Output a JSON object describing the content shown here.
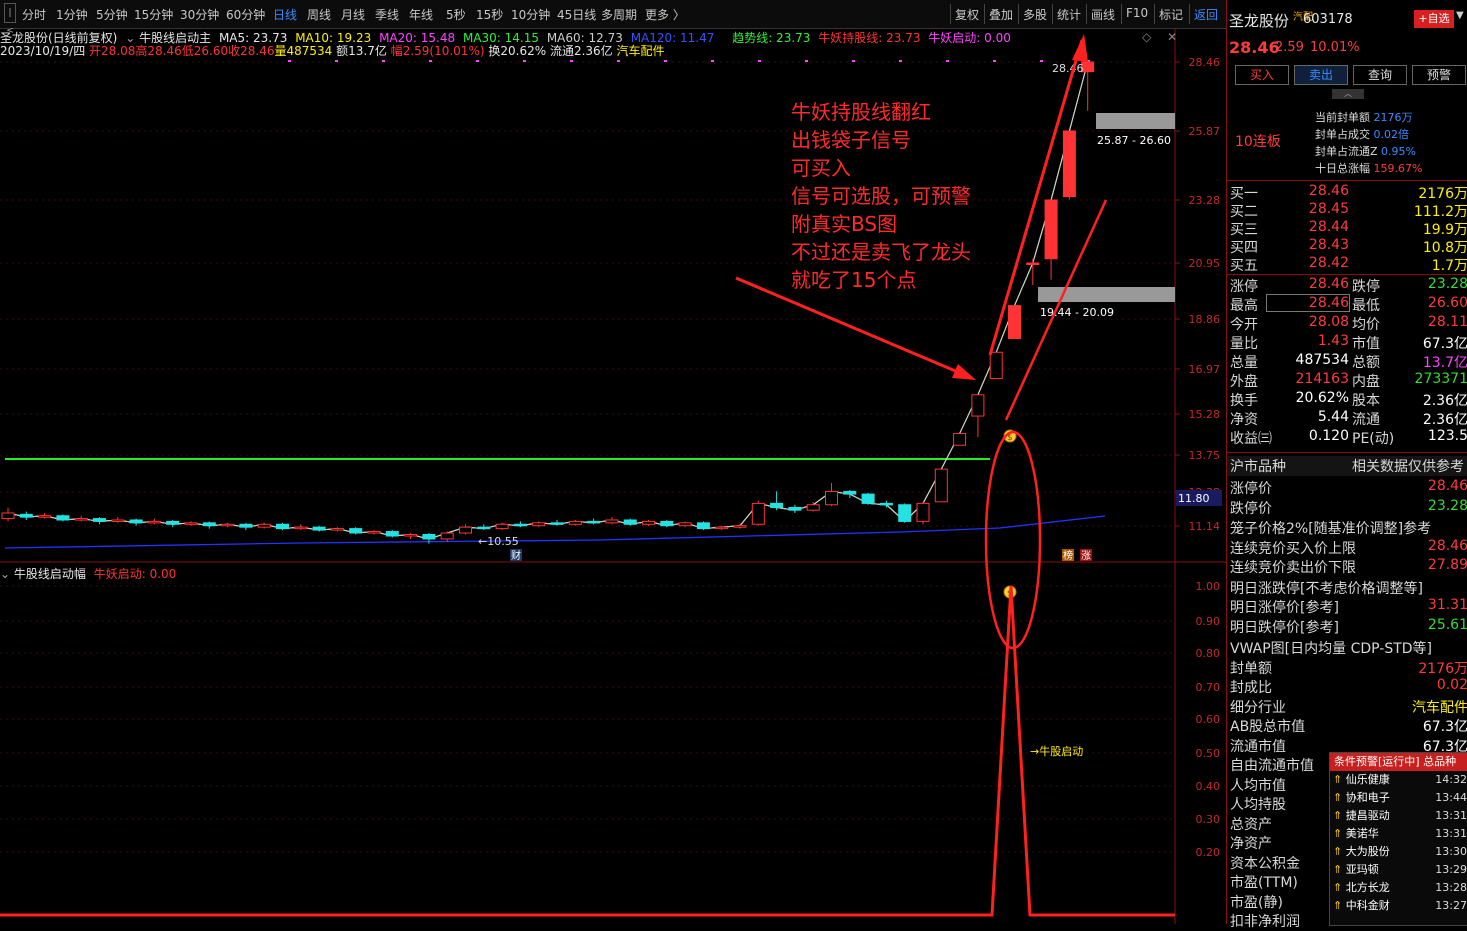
{
  "toolbar": {
    "periods": [
      "分时",
      "1分钟",
      "5分钟",
      "15分钟",
      "30分钟",
      "60分钟",
      "日线",
      "周线",
      "月线",
      "季线",
      "年线",
      "5秒",
      "15秒",
      "10分钟",
      "45日线",
      "多周期",
      "更多 〉"
    ],
    "selected": "日线",
    "right": [
      "复权",
      "叠加",
      "多股",
      "统计",
      "画线",
      "F10",
      "标记",
      "返回"
    ]
  },
  "chart_header": {
    "line1": {
      "stock": "圣龙股份(日线前复权)",
      "indicator": "牛股线启动主",
      "ma5": "MA5: 23.73",
      "ma10": "MA10: 19.23",
      "ma20": "MA20: 15.48",
      "ma30": "MA30: 14.15",
      "ma60": "MA60: 12.73",
      "ma120": "MA120: 11.47",
      "trend": "趋势线: 23.73",
      "hold": "牛妖持股线: 23.73",
      "start": "牛妖启动: 0.00"
    },
    "line2": {
      "date": "2023/10/19/四",
      "open": "开28.08",
      "high": "高28.46",
      "low": "低26.60",
      "close": "收28.46",
      "vol": "量487534",
      "amt": "额13.7亿",
      "chg": "幅2.59(10.01%)",
      "turn": "换20.62%",
      "float": "流通2.36亿",
      "sector": "汽车配件"
    }
  },
  "sub_header": {
    "name": "牛股线启动幅",
    "value": "牛妖启动: 0.00"
  },
  "price_axis": [
    "28.46",
    "25.87",
    "23.28",
    "20.95",
    "18.86",
    "16.97",
    "15.28",
    "13.75",
    "12.38",
    "11.14"
  ],
  "sub_axis": [
    "1.00",
    "0.90",
    "0.80",
    "0.70",
    "0.60",
    "0.50",
    "0.40",
    "0.30",
    "0.20"
  ],
  "current_price_tag": "11.80",
  "zone_labels": [
    "25.87 - 26.60",
    "19.44 - 20.09"
  ],
  "chart_labels": {
    "low_mark": "←10.55",
    "high_mark": "28.46",
    "cai": "财",
    "bang": "榜",
    "zhang": "涨",
    "start_label": "→牛股启动"
  },
  "annotation": [
    "牛妖持股线翻红",
    "出钱袋子信号",
    "可买入",
    "信号可选股，可预警",
    "附真实BS图",
    "不过还是卖飞了龙头",
    "就吃了15个点"
  ],
  "colors": {
    "up": "#ff3333",
    "down": "#25e2e2",
    "accent": "#3a8cff",
    "bg": "#000000",
    "annotation": "#ff2a2a"
  },
  "chart_data": {
    "type": "candlestick",
    "series": [
      {
        "name": "圣龙股份",
        "candles": [
          [
            11.4,
            11.6,
            11.8,
            11.3
          ],
          [
            11.55,
            11.45,
            11.65,
            11.35
          ],
          [
            11.45,
            11.5,
            11.6,
            11.4
          ],
          [
            11.5,
            11.35,
            11.55,
            11.3
          ],
          [
            11.35,
            11.4,
            11.5,
            11.3
          ],
          [
            11.4,
            11.3,
            11.45,
            11.2
          ],
          [
            11.3,
            11.35,
            11.45,
            11.25
          ],
          [
            11.35,
            11.25,
            11.4,
            11.15
          ],
          [
            11.25,
            11.3,
            11.4,
            11.2
          ],
          [
            11.3,
            11.2,
            11.35,
            11.1
          ],
          [
            11.2,
            11.25,
            11.3,
            11.15
          ],
          [
            11.25,
            11.15,
            11.3,
            11.05
          ],
          [
            11.15,
            11.2,
            11.25,
            11.1
          ],
          [
            11.2,
            11.1,
            11.25,
            11.0
          ],
          [
            11.1,
            11.2,
            11.25,
            11.05
          ],
          [
            11.2,
            11.05,
            11.25,
            11.0
          ],
          [
            11.05,
            11.1,
            11.2,
            11.0
          ],
          [
            11.1,
            11.0,
            11.15,
            10.95
          ],
          [
            11.0,
            11.05,
            11.1,
            10.95
          ],
          [
            11.05,
            10.9,
            11.1,
            10.85
          ],
          [
            10.9,
            10.95,
            11.0,
            10.85
          ],
          [
            10.95,
            10.8,
            11.0,
            10.75
          ],
          [
            10.8,
            10.85,
            10.9,
            10.7
          ],
          [
            10.85,
            10.7,
            10.9,
            10.55
          ],
          [
            10.7,
            10.9,
            10.95,
            10.6
          ],
          [
            10.9,
            11.1,
            11.2,
            10.85
          ],
          [
            11.1,
            11.05,
            11.2,
            11.0
          ],
          [
            11.05,
            11.2,
            11.25,
            11.0
          ],
          [
            11.2,
            11.15,
            11.3,
            11.1
          ],
          [
            11.15,
            11.25,
            11.3,
            11.1
          ],
          [
            11.25,
            11.2,
            11.35,
            11.15
          ],
          [
            11.2,
            11.3,
            11.35,
            11.15
          ],
          [
            11.3,
            11.25,
            11.4,
            11.2
          ],
          [
            11.25,
            11.35,
            11.45,
            11.2
          ],
          [
            11.35,
            11.2,
            11.4,
            11.15
          ],
          [
            11.2,
            11.3,
            11.35,
            11.15
          ],
          [
            11.3,
            11.15,
            11.35,
            11.1
          ],
          [
            11.15,
            11.25,
            11.3,
            11.1
          ],
          [
            11.25,
            11.05,
            11.3,
            11.0
          ],
          [
            11.05,
            11.1,
            11.15,
            11.0
          ],
          [
            11.1,
            11.15,
            11.2,
            11.05
          ],
          [
            11.2,
            11.95,
            12.05,
            11.15
          ],
          [
            11.95,
            11.8,
            12.4,
            11.7
          ],
          [
            11.8,
            11.7,
            11.9,
            11.6
          ],
          [
            11.7,
            11.9,
            12.0,
            11.65
          ],
          [
            11.9,
            12.4,
            12.7,
            11.85
          ],
          [
            12.4,
            12.3,
            12.45,
            12.15
          ],
          [
            12.3,
            11.95,
            12.35,
            11.9
          ],
          [
            11.95,
            11.9,
            12.05,
            11.8
          ],
          [
            11.9,
            11.3,
            11.95,
            11.25
          ],
          [
            11.3,
            11.95,
            12.0,
            11.2
          ],
          [
            12.01,
            13.21,
            13.21,
            12.01
          ],
          [
            14.1,
            14.53,
            14.53,
            14.1
          ],
          [
            15.2,
            15.98,
            15.98,
            14.4
          ],
          [
            16.6,
            17.58,
            17.58,
            16.6
          ],
          [
            18.1,
            19.34,
            19.34,
            18.1
          ],
          [
            20.95,
            20.95,
            21.1,
            20.1
          ],
          [
            21.1,
            23.28,
            23.28,
            20.3
          ],
          [
            23.4,
            25.87,
            25.87,
            23.3
          ],
          [
            28.08,
            28.46,
            28.46,
            26.6
          ]
        ]
      }
    ],
    "ylim": [
      10.5,
      28.5
    ],
    "lines": [
      "MA5",
      "MA10",
      "MA20",
      "MA30",
      "MA60",
      "MA120"
    ],
    "signal": {
      "name": "牛妖启动",
      "values_at_last_days": [
        0,
        0,
        0,
        0,
        0,
        0,
        0,
        1,
        0,
        0,
        0,
        0,
        0,
        0,
        0
      ]
    }
  },
  "right_panel": {
    "name": "圣龙股份",
    "small_tag": "汽配",
    "code": "603178",
    "add_btn": "+自选",
    "price": "28.46",
    "chg": "2.59",
    "pct": "10.01%",
    "buttons": [
      "买入",
      "卖出",
      "查询",
      "预警"
    ],
    "streak": "10连板",
    "seal_info": [
      {
        "k": "当前封单额",
        "v": "2176万"
      },
      {
        "k": "封单占成交",
        "v": "0.02倍"
      },
      {
        "k": "封单占流通Z",
        "v": "0.95%"
      },
      {
        "k": "十日总涨幅",
        "v": "159.67%"
      }
    ],
    "book": [
      [
        "买一",
        "28.46",
        "2176万"
      ],
      [
        "买二",
        "28.45",
        "111.2万"
      ],
      [
        "买三",
        "28.44",
        "19.9万"
      ],
      [
        "买四",
        "28.43",
        "10.8万"
      ],
      [
        "买五",
        "28.42",
        "1.7万"
      ]
    ],
    "quote": [
      [
        "涨停",
        "28.46",
        "跌停",
        "23.28"
      ],
      [
        "最高",
        "28.46",
        "最低",
        "26.60"
      ],
      [
        "今开",
        "28.08",
        "均价",
        "28.11"
      ],
      [
        "量比",
        "1.43",
        "市值",
        "67.3亿"
      ],
      [
        "总量",
        "487534",
        "总额",
        "13.7亿"
      ],
      [
        "外盘",
        "214163",
        "内盘",
        "273371"
      ],
      [
        "换手",
        "20.62%",
        "股本",
        "2.36亿"
      ],
      [
        "净资",
        "5.44",
        "流通",
        "2.36亿"
      ],
      [
        "收益㈢",
        "0.120",
        "PE(动)",
        "123.5"
      ]
    ],
    "market_title": "沪市品种",
    "market_note": "相关数据仅供参考",
    "limits": [
      [
        "涨停价",
        "28.46"
      ],
      [
        "跌停价",
        "23.28"
      ]
    ],
    "cage_title": "笼子价格2%[随基准价调整]参考",
    "cage": [
      [
        "连续竞价买入价上限",
        "28.46"
      ],
      [
        "连续竞价卖出价下限",
        "27.89"
      ]
    ],
    "tomorrow_title": "明日涨跌停[不考虑价格调整等]",
    "tomorrow": [
      [
        "明日涨停价[参考]",
        "31.31"
      ],
      [
        "明日跌停价[参考]",
        "25.61"
      ]
    ],
    "vwap": "VWAP图[日内均量 CDP-STD等]",
    "seal": [
      [
        "封单额",
        "2176万"
      ],
      [
        "封成比",
        "0.02"
      ]
    ],
    "industry_k": "细分行业",
    "industry_v": "汽车配件",
    "caps": [
      [
        "AB股总市值",
        "67.3亿"
      ],
      [
        "流通市值",
        "67.3亿"
      ]
    ],
    "others": [
      "自由流通市值",
      "人均市值",
      "人均持股",
      "总资产",
      "净资产",
      "资本公积金",
      "市盈(TTM)",
      "市盈(静)",
      "扣非净利润"
    ],
    "alert_title": "条件预警[运行中] 总品种",
    "alerts": [
      [
        "仙乐健康",
        "14:32"
      ],
      [
        "协和电子",
        "13:44"
      ],
      [
        "捷昌驱动",
        "13:31"
      ],
      [
        "美诺华",
        "13:31"
      ],
      [
        "大为股份",
        "13:30"
      ],
      [
        "亚玛顿",
        "13:29"
      ],
      [
        "北方长龙",
        "13:28"
      ],
      [
        "中科金财",
        "13:27"
      ]
    ]
  }
}
